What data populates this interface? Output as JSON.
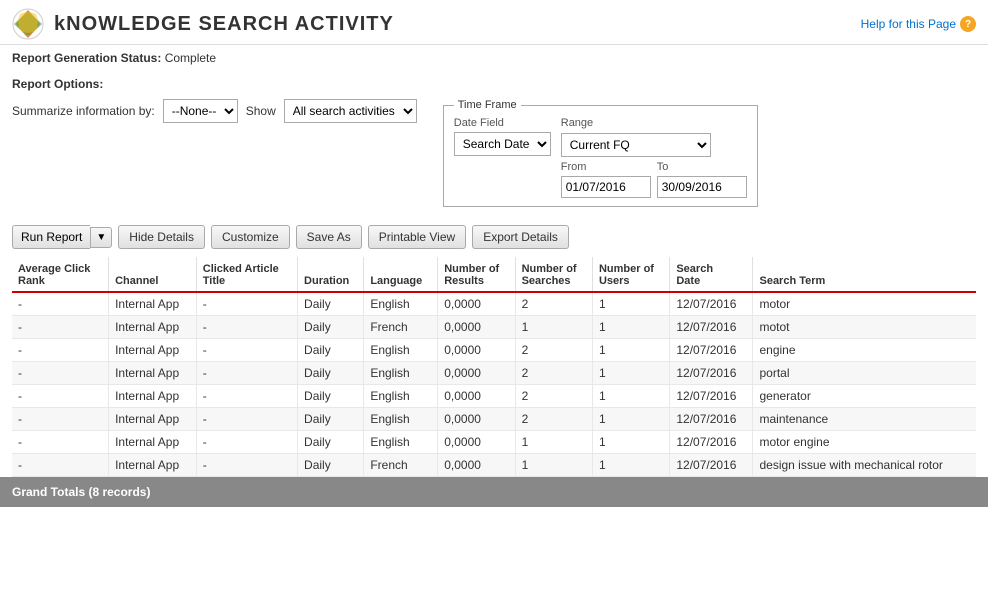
{
  "header": {
    "title": "kNOWLEDGE SEARCH ACTIVITY",
    "help_link": "Help for this Page"
  },
  "status": {
    "label": "Report Generation Status:",
    "value": "Complete"
  },
  "report_options": {
    "title": "Report Options:",
    "summarize_label": "Summarize information by:",
    "show_label": "Show",
    "summarize_value": "--None--",
    "show_value": "All search activities",
    "timeframe": {
      "legend": "Time Frame",
      "date_field_label": "Date Field",
      "date_field_value": "Search Date",
      "range_label": "Range",
      "range_value": "Current FQ",
      "from_label": "From",
      "from_value": "01/07/2016",
      "to_label": "To",
      "to_value": "30/09/2016"
    }
  },
  "toolbar": {
    "run_report": "Run Report",
    "hide_details": "Hide Details",
    "customize": "Customize",
    "save_as": "Save As",
    "printable_view": "Printable View",
    "export_details": "Export Details"
  },
  "table": {
    "columns": [
      "Average Click Rank",
      "Channel",
      "Clicked Article Title",
      "Duration",
      "Language",
      "Number of Results",
      "Number of Searches",
      "Number of Users",
      "Search Date",
      "Search Term"
    ],
    "rows": [
      {
        "avg_click_rank": "-",
        "channel": "Internal App",
        "clicked_article_title": "-",
        "duration": "Daily",
        "language": "English",
        "number_of_results": "0,0000",
        "number_of_searches": "2",
        "number_of_users": "1",
        "search_date": "12/07/2016",
        "search_term": "motor"
      },
      {
        "avg_click_rank": "-",
        "channel": "Internal App",
        "clicked_article_title": "-",
        "duration": "Daily",
        "language": "French",
        "number_of_results": "0,0000",
        "number_of_searches": "1",
        "number_of_users": "1",
        "search_date": "12/07/2016",
        "search_term": "motot"
      },
      {
        "avg_click_rank": "-",
        "channel": "Internal App",
        "clicked_article_title": "-",
        "duration": "Daily",
        "language": "English",
        "number_of_results": "0,0000",
        "number_of_searches": "2",
        "number_of_users": "1",
        "search_date": "12/07/2016",
        "search_term": "engine"
      },
      {
        "avg_click_rank": "-",
        "channel": "Internal App",
        "clicked_article_title": "-",
        "duration": "Daily",
        "language": "English",
        "number_of_results": "0,0000",
        "number_of_searches": "2",
        "number_of_users": "1",
        "search_date": "12/07/2016",
        "search_term": "portal"
      },
      {
        "avg_click_rank": "-",
        "channel": "Internal App",
        "clicked_article_title": "-",
        "duration": "Daily",
        "language": "English",
        "number_of_results": "0,0000",
        "number_of_searches": "2",
        "number_of_users": "1",
        "search_date": "12/07/2016",
        "search_term": "generator"
      },
      {
        "avg_click_rank": "-",
        "channel": "Internal App",
        "clicked_article_title": "-",
        "duration": "Daily",
        "language": "English",
        "number_of_results": "0,0000",
        "number_of_searches": "2",
        "number_of_users": "1",
        "search_date": "12/07/2016",
        "search_term": "maintenance"
      },
      {
        "avg_click_rank": "-",
        "channel": "Internal App",
        "clicked_article_title": "-",
        "duration": "Daily",
        "language": "English",
        "number_of_results": "0,0000",
        "number_of_searches": "1",
        "number_of_users": "1",
        "search_date": "12/07/2016",
        "search_term": "motor engine"
      },
      {
        "avg_click_rank": "-",
        "channel": "Internal App",
        "clicked_article_title": "-",
        "duration": "Daily",
        "language": "French",
        "number_of_results": "0,0000",
        "number_of_searches": "1",
        "number_of_users": "1",
        "search_date": "12/07/2016",
        "search_term": "design issue with mechanical rotor"
      }
    ]
  },
  "grand_totals": {
    "label": "Grand Totals (8 records)"
  }
}
